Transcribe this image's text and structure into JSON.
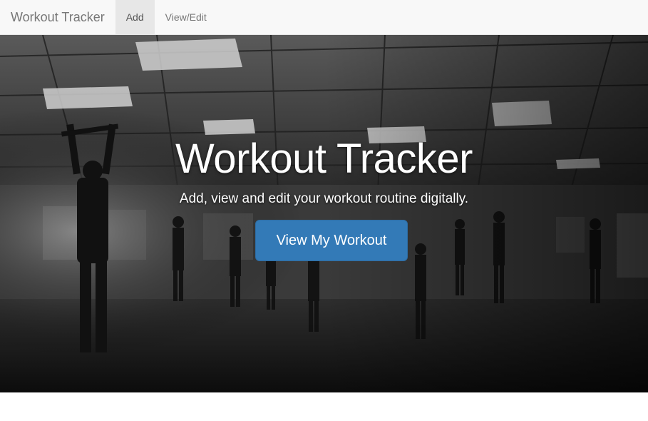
{
  "navbar": {
    "brand": "Workout Tracker",
    "items": [
      {
        "label": "Add",
        "active": true
      },
      {
        "label": "View/Edit",
        "active": false
      }
    ]
  },
  "hero": {
    "title": "Workout Tracker",
    "subtitle": "Add, view and edit your workout routine digitally.",
    "button_label": "View My Workout",
    "background": "grayscale-gym-class-photo"
  },
  "colors": {
    "navbar_bg": "#f8f8f8",
    "active_tab_bg": "#e7e7e7",
    "button_bg": "#337ab7"
  }
}
